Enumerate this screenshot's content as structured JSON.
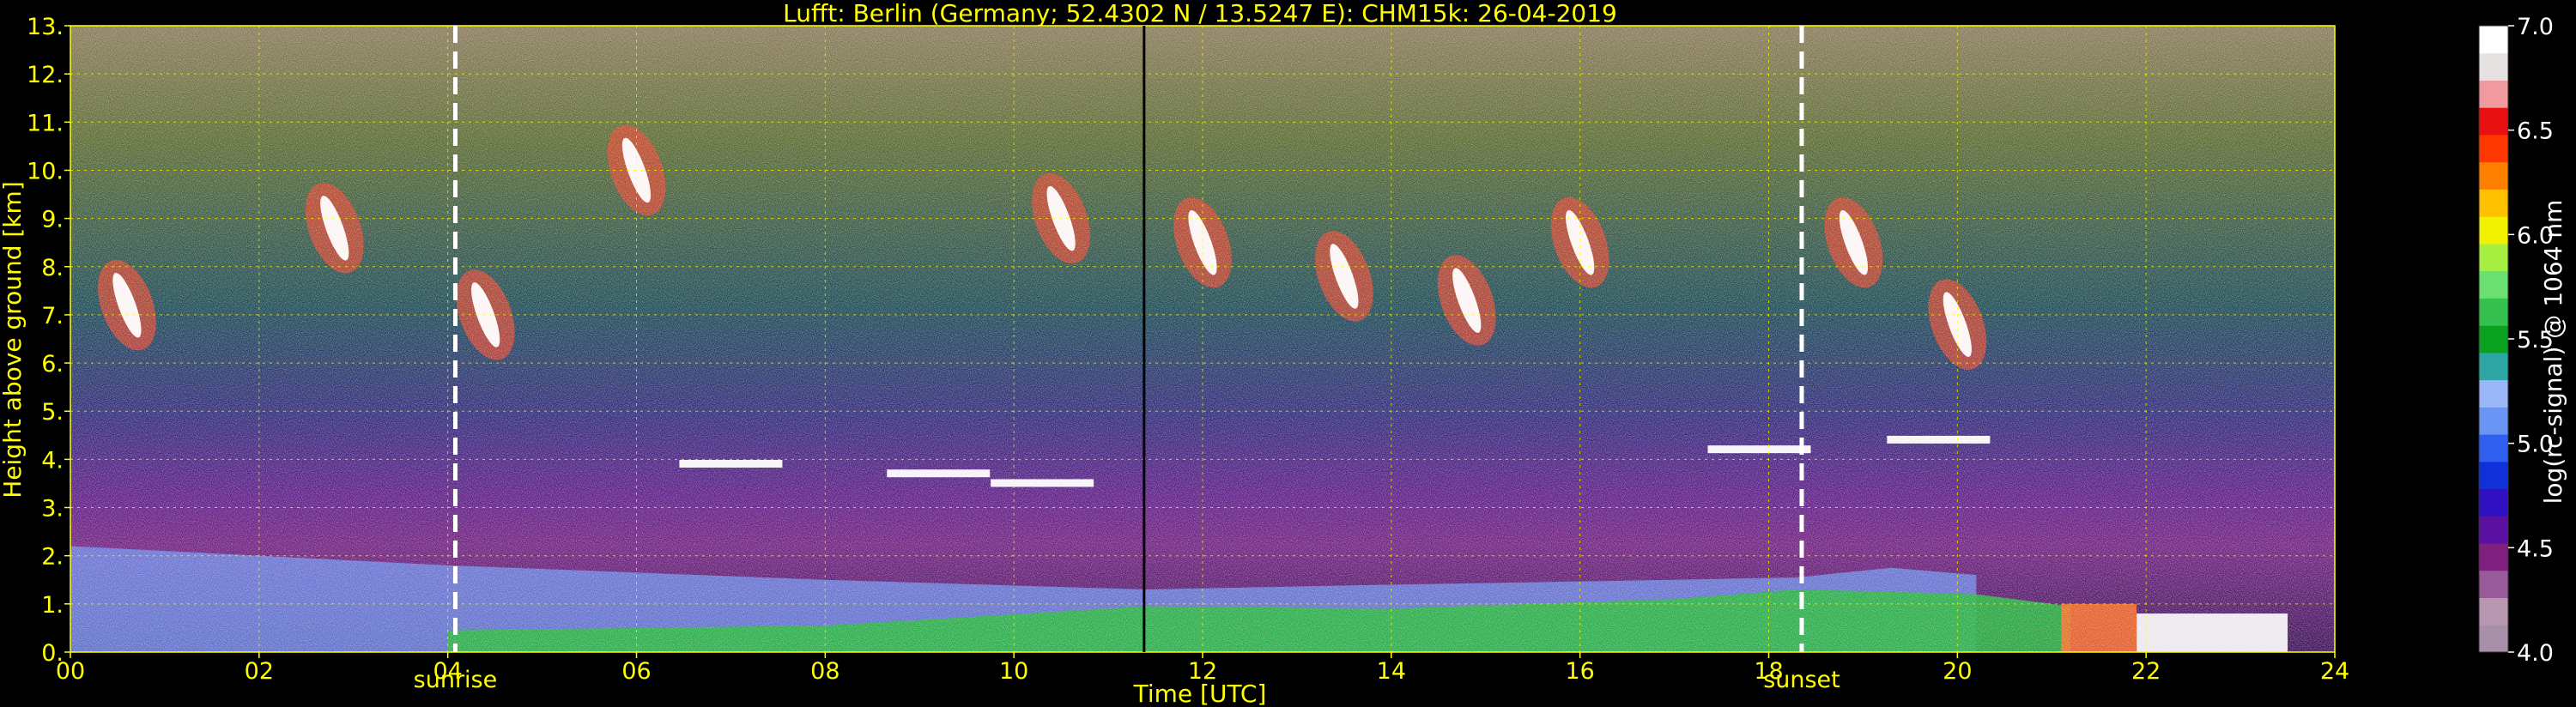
{
  "chart_data": {
    "type": "heatmap",
    "title": "Lufft: Berlin (Germany; 52.4302 N / 13.5247 E):    CHM15k: 26-04-2019",
    "xlabel": "Time [UTC]",
    "ylabel": "Height above ground [km]",
    "xlim": [
      0,
      24
    ],
    "ylim": [
      0,
      13
    ],
    "x_ticks": [
      "00",
      "02",
      "04",
      "06",
      "08",
      "10",
      "12",
      "14",
      "16",
      "18",
      "20",
      "22",
      "24"
    ],
    "y_ticks": [
      "0.",
      "1.",
      "2.",
      "3.",
      "4.",
      "5.",
      "6.",
      "7.",
      "8.",
      "9.",
      "10.",
      "11.",
      "12.",
      "13."
    ],
    "grid": true,
    "colorbar": {
      "label": "log(rc-signal) @ 1064 nm",
      "range": [
        4.0,
        7.0
      ],
      "ticks": [
        "4.0",
        "4.5",
        "5.0",
        "5.5",
        "6.0",
        "6.5",
        "7.0"
      ],
      "colors": [
        "#a890a8",
        "#b898b0",
        "#985a98",
        "#80207f",
        "#5a10a0",
        "#3010c0",
        "#1030d8",
        "#3060f0",
        "#6a95f5",
        "#9ab8f8",
        "#2ea5a5",
        "#0aa020",
        "#35c050",
        "#6ae070",
        "#a6ee40",
        "#f2f200",
        "#ffc000",
        "#ff8000",
        "#ff3800",
        "#e81010",
        "#f09aa0",
        "#e6e2e2",
        "#ffffff"
      ]
    },
    "annotations": [
      {
        "label": "sunrise",
        "x": 4.08
      },
      {
        "label": "sunset",
        "x": 18.35
      }
    ],
    "marker_line_x": 11.38,
    "layers": [
      {
        "name": "boundary layer (green)",
        "x": [
          4,
          8,
          11.4,
          14,
          17,
          18.3,
          19.3,
          20.2,
          21.2
        ],
        "y_top": [
          0.45,
          0.55,
          0.95,
          0.9,
          1.1,
          1.3,
          1.25,
          1.2,
          0.95
        ]
      },
      {
        "name": "aerosol layer (blue)",
        "x": [
          0,
          4,
          8,
          11.4,
          14,
          17,
          18.3,
          19.3,
          20.2
        ],
        "y_top": [
          2.2,
          1.8,
          1.5,
          1.3,
          1.4,
          1.5,
          1.55,
          1.75,
          1.6
        ]
      },
      {
        "name": "cirrus clouds",
        "x": [
          0.6,
          2.8,
          4.4,
          6.0,
          10.5,
          12.0,
          13.5,
          14.8,
          16.0,
          18.9,
          20.0
        ],
        "y": [
          7.2,
          8.8,
          7.0,
          10.0,
          9.0,
          8.5,
          7.8,
          7.3,
          8.5,
          8.5,
          6.8
        ]
      },
      {
        "name": "mid-level cloud",
        "x": [
          7.0,
          9.2,
          10.3,
          17.9,
          19.8
        ],
        "y": [
          3.9,
          3.7,
          3.5,
          4.2,
          4.4
        ]
      }
    ]
  }
}
